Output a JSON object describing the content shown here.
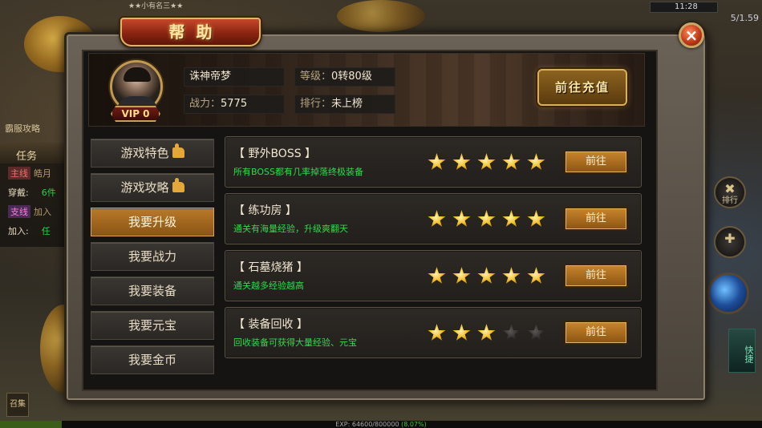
{
  "hud": {
    "top_left_text": "★★小有名三★★",
    "clock_time": "11:28",
    "clock_sub": "5/1.59",
    "left_link": "霸服攻略",
    "task_title": "任务",
    "task_rows": [
      {
        "tag": "主线",
        "tag_style": "red",
        "value": "皓月",
        "extra": ""
      },
      {
        "tag": "穿戴:",
        "tag_style": "plain",
        "value": "",
        "extra": "6件"
      },
      {
        "tag": "支线",
        "tag_style": "purple",
        "value": "加入",
        "extra": ""
      },
      {
        "tag": "加入:",
        "tag_style": "plain",
        "value": "",
        "extra": "任"
      }
    ],
    "right_btn_1": {
      "symbol": "✖",
      "label": "排行"
    },
    "right_btn_2": {
      "symbol": "✚",
      "label": ""
    },
    "side_strip": "快捷",
    "corner_btn": "召集",
    "exp_label": "EXP: 64600/800000",
    "exp_pct": "(8.07%)",
    "exp_fraction": 0.0807
  },
  "dialog": {
    "title": "帮助",
    "close_symbol": "×"
  },
  "player": {
    "name": "诛神帝梦",
    "vip": "VIP 0",
    "level_label": "等级：",
    "level_value": "0转80级",
    "power_label": "战力：",
    "power_value": "5775",
    "rank_label": "排行：",
    "rank_value": "未上榜",
    "recharge_label": "前往充值"
  },
  "nav": [
    {
      "label": "游戏特色",
      "thumb": true,
      "active": false
    },
    {
      "label": "游戏攻略",
      "thumb": true,
      "active": false
    },
    {
      "label": "我要升级",
      "thumb": false,
      "active": true
    },
    {
      "label": "我要战力",
      "thumb": false,
      "active": false
    },
    {
      "label": "我要装备",
      "thumb": false,
      "active": false
    },
    {
      "label": "我要元宝",
      "thumb": false,
      "active": false
    },
    {
      "label": "我要金币",
      "thumb": false,
      "active": false
    }
  ],
  "items": [
    {
      "title": "【 野外BOSS 】",
      "desc": "所有BOSS都有几率掉落终极装备",
      "stars": 5,
      "max_stars": 5,
      "button": "前往"
    },
    {
      "title": "【 练功房 】",
      "desc": "通关有海量经验，升级爽翻天",
      "stars": 5,
      "max_stars": 5,
      "button": "前往"
    },
    {
      "title": "【 石墓烧猪 】",
      "desc": "通关越多经验越高",
      "stars": 5,
      "max_stars": 5,
      "button": "前往"
    },
    {
      "title": "【 装备回收 】",
      "desc": "回收装备可获得大量经验、元宝",
      "stars": 3,
      "max_stars": 5,
      "button": "前往"
    }
  ]
}
